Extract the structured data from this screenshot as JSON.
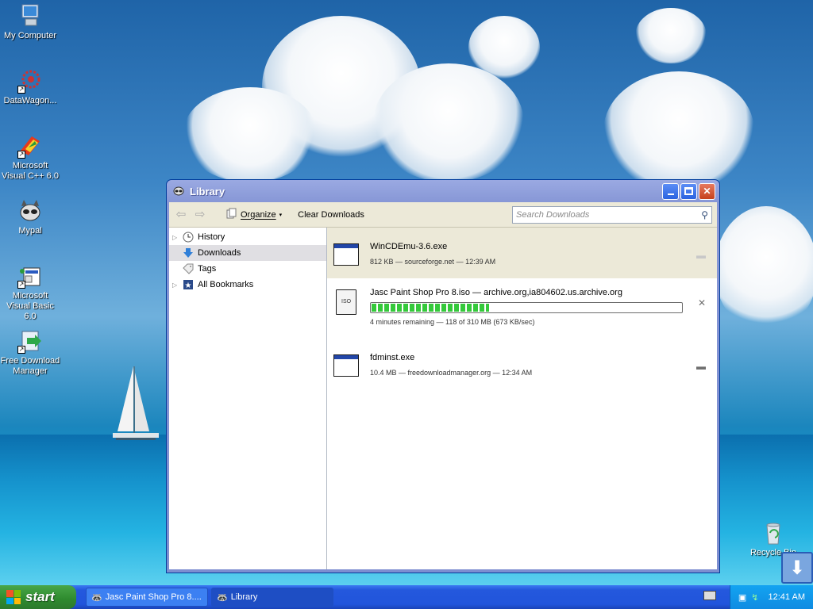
{
  "desktop": {
    "icons": [
      {
        "label": "My Computer",
        "icon": "computer-icon"
      },
      {
        "label": "DataWagon...",
        "icon": "datawagon-icon"
      },
      {
        "label": "Microsoft Visual C++ 6.0",
        "icon": "visual-cpp-icon"
      },
      {
        "label": "Mypal",
        "icon": "mypal-icon"
      },
      {
        "label": "Microsoft Visual Basic 6.0",
        "icon": "visual-basic-icon"
      },
      {
        "label": "Free Download Manager",
        "icon": "fdm-icon"
      }
    ],
    "recycle_bin_label": "Recycle Bin"
  },
  "window": {
    "title": "Library",
    "toolbar": {
      "organize_label": "Organize",
      "clear_label": "Clear Downloads",
      "search_placeholder": "Search Downloads"
    },
    "sidebar": [
      {
        "label": "History",
        "icon": "clock-icon"
      },
      {
        "label": "Downloads",
        "icon": "download-arrow-icon",
        "selected": true
      },
      {
        "label": "Tags",
        "icon": "tag-icon"
      },
      {
        "label": "All Bookmarks",
        "icon": "bookmark-star-icon"
      }
    ],
    "downloads": [
      {
        "name": "WinCDEmu-3.6.exe",
        "meta": "812 KB — sourceforge.net — 12:39 AM",
        "status": "done",
        "action_icon": "folder-icon"
      },
      {
        "name": "Jasc Paint Shop Pro 8.iso — archive.org,ia804602.us.archive.org",
        "meta": "4 minutes remaining — 118 of 310 MB (673 KB/sec)",
        "status": "downloading",
        "progress": 0.38,
        "action_icon": "cancel-icon"
      },
      {
        "name": "fdminst.exe",
        "meta": "10.4 MB — freedownloadmanager.org — 12:34 AM",
        "status": "done",
        "action_icon": "folder-icon"
      }
    ]
  },
  "taskbar": {
    "start_label": "start",
    "tasks": [
      {
        "label": "Jasc Paint Shop Pro 8....",
        "icon": "mypal-icon"
      },
      {
        "label": "Library",
        "icon": "mypal-icon"
      }
    ],
    "clock": "12:41 AM"
  }
}
